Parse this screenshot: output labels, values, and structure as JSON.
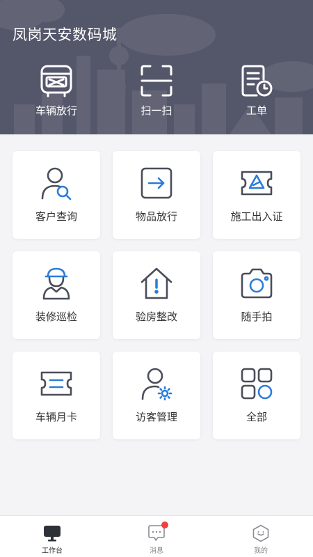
{
  "header": {
    "title": "凤岗天安数码城",
    "quick_actions": [
      {
        "label": "车辆放行",
        "icon": "bus-icon"
      },
      {
        "label": "扫一扫",
        "icon": "scan-icon"
      },
      {
        "label": "工单",
        "icon": "work-order-icon"
      }
    ]
  },
  "grid": {
    "items": [
      {
        "label": "客户查询",
        "icon": "customer-search-icon"
      },
      {
        "label": "物品放行",
        "icon": "item-release-icon"
      },
      {
        "label": "施工出入证",
        "icon": "construction-pass-icon"
      },
      {
        "label": "装修巡检",
        "icon": "worker-helmet-icon"
      },
      {
        "label": "验房整改",
        "icon": "house-alert-icon"
      },
      {
        "label": "随手拍",
        "icon": "camera-icon"
      },
      {
        "label": "车辆月卡",
        "icon": "ticket-icon"
      },
      {
        "label": "访客管理",
        "icon": "visitor-settings-icon"
      },
      {
        "label": "全部",
        "icon": "apps-grid-icon"
      }
    ]
  },
  "tabbar": {
    "tabs": [
      {
        "label": "工作台",
        "icon": "monitor-icon",
        "active": true
      },
      {
        "label": "消息",
        "icon": "message-icon",
        "has_badge": true
      },
      {
        "label": "我的",
        "icon": "profile-icon"
      }
    ]
  },
  "colors": {
    "header_bg": "#54576a",
    "accent": "#2b7cd9",
    "icon_dark": "#4a4d5a",
    "badge": "#f04040"
  }
}
